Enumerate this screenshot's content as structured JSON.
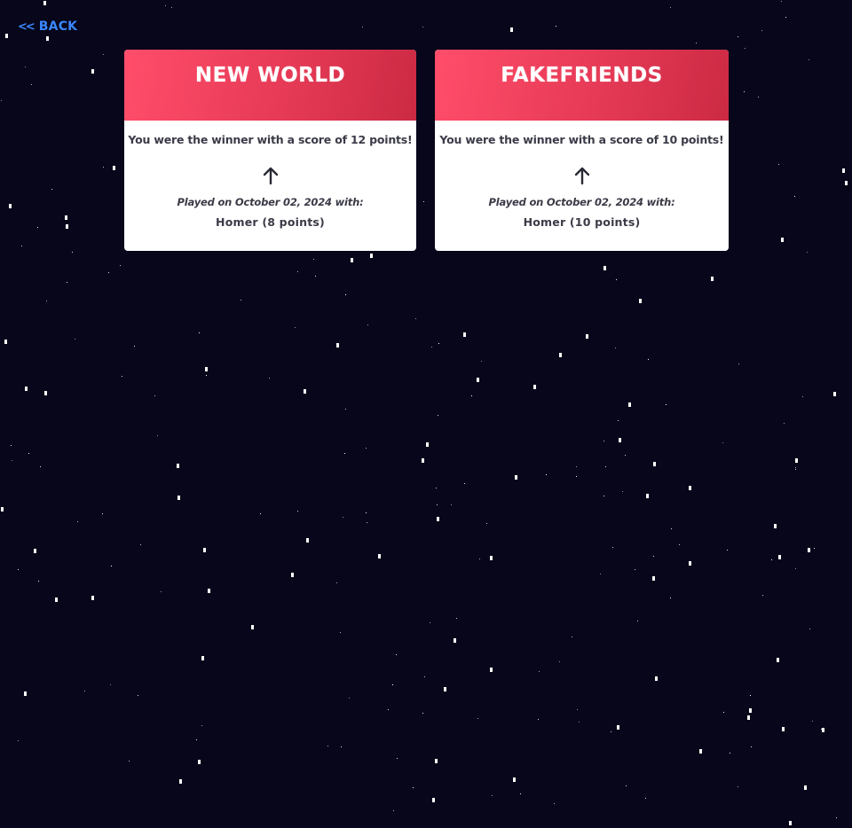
{
  "nav": {
    "back_chevron": "<<",
    "back_label": "BACK"
  },
  "games": [
    {
      "title": "NEW WORLD",
      "result": "You were the winner with a score of 12 points!",
      "icon": "arrow-up-icon",
      "played_on": "Played on October 02, 2024 with:",
      "players": "Homer (8 points)"
    },
    {
      "title": "FAKEFRIENDS",
      "result": "You were the winner with a score of 10 points!",
      "icon": "arrow-up-icon",
      "played_on": "Played on October 02, 2024 with:",
      "players": "Homer (10 points)"
    }
  ],
  "colors": {
    "background": "#07061a",
    "accent": "#3a86ff",
    "card_header_start": "#ff4d6a",
    "card_header_end": "#cc2a44",
    "card_text": "#3b3b48"
  }
}
